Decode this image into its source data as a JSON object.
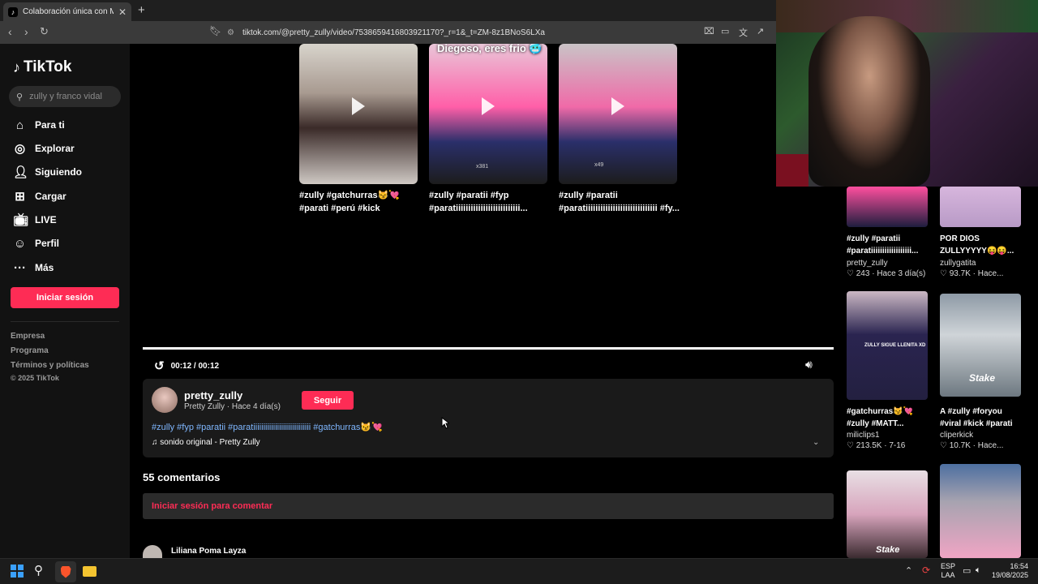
{
  "browser": {
    "tab_title": "Colaboración única con Matnaru",
    "url": "tiktok.com/@pretty_zully/video/7538659416803921170?_r=1&_t=ZM-8z1BNoS6LXa"
  },
  "sidebar": {
    "logo": "TikTok",
    "search_placeholder": "zully y franco vidal",
    "items": [
      {
        "label": "Para ti",
        "icon": "home-icon"
      },
      {
        "label": "Explorar",
        "icon": "compass-icon"
      },
      {
        "label": "Siguiendo",
        "icon": "users-icon"
      },
      {
        "label": "Cargar",
        "icon": "plus-square-icon"
      },
      {
        "label": "LIVE",
        "icon": "tv-icon"
      },
      {
        "label": "Perfil",
        "icon": "user-icon"
      },
      {
        "label": "Más",
        "icon": "more-icon"
      }
    ],
    "login_label": "Iniciar sesión",
    "footer": [
      "Empresa",
      "Programa",
      "Términos y políticas",
      "© 2025 TikTok"
    ]
  },
  "related": [
    {
      "caption_line1": "#zully #gatchurras😼💘",
      "caption_line2": "#parati #perú #kick"
    },
    {
      "caption_line1": "#zully #paratii #fyp",
      "caption_line2": "#paratiiiiiiiiiiiiiiiiiiiiiiiiii...",
      "overlay_text": "Diegoso, eres frio 🥶",
      "counter": "x381"
    },
    {
      "caption_line1": "#zully #paratii",
      "caption_line2": "#paratiiiiiiiiiiiiiiiiiiiiiiiiiiiii #fy...",
      "counter": "x49"
    }
  ],
  "player": {
    "time": "00:12 / 00:12",
    "progress": 1.0
  },
  "video_info": {
    "username": "pretty_zully",
    "subtitle": "Pretty Zully · Hace 4 día(s)",
    "follow_label": "Seguir",
    "description": "#zully #fyp #paratii #paratiiiiiiiiiiiiiiiiiiiiiiiiiiiii #gatchurras😼💘",
    "music": "♫ sonido original - Pretty Zully"
  },
  "comments": {
    "count_label": "55 comentarios",
    "login_prompt": "Iniciar sesión para comentar",
    "first_author": "Liliana Poma Layza"
  },
  "right_videos": [
    {
      "line1": "#zully #paratii",
      "line2": "#paratiiiiiiiiiiiiiiiiii...",
      "author": "pretty_zully",
      "meta": "♡ 243 · Hace 3 día(s)"
    },
    {
      "line1": "POR DIOS",
      "line2": "ZULLYYYYY😝😝...",
      "author": "zullygatita",
      "meta": "♡ 93.7K · Hace..."
    },
    {
      "line1": "#gatchurras😼💘",
      "line2": "#zully #MATT...",
      "author": "miliclips1",
      "meta": "♡ 213.5K · 7-16",
      "overlay": "ZULLY SIGUE LLENITA XD"
    },
    {
      "line1": "A #zully #foryou",
      "line2": "#viral #kick #parati",
      "author": "cliperkick",
      "meta": "♡ 10.7K · Hace...",
      "overlay": "Stake"
    },
    {
      "overlay": "Stake"
    },
    {}
  ],
  "taskbar": {
    "lang": "ESP",
    "lang_sub": "LAA",
    "time": "16:54",
    "date": "19/08/2025"
  }
}
